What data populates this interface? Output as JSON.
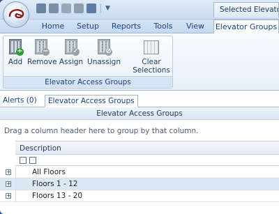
{
  "window": {
    "contextual_title": "Selected  Elevator..."
  },
  "quick_access": [
    "save-icon",
    "save-all-icon",
    "print-icon",
    "print-preview-icon",
    "flag-icon"
  ],
  "tabs": [
    {
      "label": "Home"
    },
    {
      "label": "Setup"
    },
    {
      "label": "Reports"
    },
    {
      "label": "Tools"
    },
    {
      "label": "View"
    },
    {
      "label": "Elevator Groups"
    }
  ],
  "ribbon": {
    "group_label": "Elevator Access Groups",
    "buttons": [
      {
        "label": "Add",
        "icon": "building-add-icon"
      },
      {
        "label": "Remove",
        "icon": "building-remove-icon"
      },
      {
        "label": "Assign",
        "icon": "assign-icon"
      },
      {
        "label": "Unassign",
        "icon": "unassign-icon"
      },
      {
        "label": "Clear\nSelections",
        "line1": "Clear",
        "line2": "Selections",
        "icon": "grid-clear-icon"
      }
    ]
  },
  "lower_tabs": [
    {
      "label": "Alerts (0)"
    },
    {
      "label": "Elevator Access Groups"
    }
  ],
  "grid": {
    "title": "Elevator Access Groups",
    "group_hint": "Drag a column header here to group by that column.",
    "column": "Description",
    "rows": [
      {
        "label": "All Floors"
      },
      {
        "label": "Floors 1 - 12"
      },
      {
        "label": "Floors 13 - 20"
      }
    ]
  }
}
